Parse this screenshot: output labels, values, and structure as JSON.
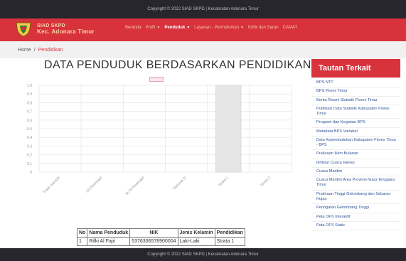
{
  "topbar": {
    "copyright": "Copyright © 2022 SIAD SKPD | Kecamatan Adonara Timur"
  },
  "brand": {
    "line1": "SIAD SKPD",
    "line2": "Kec. Adonara Timur"
  },
  "menu": {
    "items": [
      {
        "label": "Beranda",
        "dropdown": false,
        "active": false
      },
      {
        "label": "Profil",
        "dropdown": true,
        "active": false
      },
      {
        "label": "Penduduk",
        "dropdown": true,
        "active": true
      },
      {
        "label": "Layanan - Permohonan",
        "dropdown": true,
        "active": false
      },
      {
        "label": "Kritik dan Saran",
        "dropdown": false,
        "active": false
      },
      {
        "label": "CAMAT",
        "dropdown": false,
        "active": false
      }
    ]
  },
  "breadcrumb": {
    "home": "Home",
    "separator": "/",
    "current": "Pendidikan"
  },
  "page": {
    "title": "DATA PENDUDUK BERDASARKAN PENDIDIKAN"
  },
  "chart_data": {
    "type": "bar",
    "categories": [
      "Tidak Sekolah",
      "SD/Sederajat",
      "SLTP/Sederajat",
      "Diploma III",
      "Strata 1",
      "Strata 2"
    ],
    "values": [
      0,
      0,
      0,
      0,
      1,
      0
    ],
    "ylim": [
      0,
      1
    ],
    "yticks": [
      "0",
      "0.1",
      "0.2",
      "0.3",
      "0.4",
      "0.5",
      "0.6",
      "0.7",
      "0.8",
      "0.9",
      "1.0"
    ],
    "grid": true,
    "legend": "top-center",
    "colors": {
      "bar_fill": "#e6e6e6",
      "bar_stroke": "#d9d9d9",
      "legend_stroke": "#e8a0b0",
      "legend_fill": "#fbe5ea"
    }
  },
  "table": {
    "headers": [
      "No",
      "Nama Penduduk",
      "NIK",
      "Jenis Kelamin",
      "Pendidikan"
    ],
    "rows": [
      [
        "1",
        "Rifki Al Fajri",
        "5376306578900004",
        "Laki-Laki",
        "Strata 1"
      ]
    ]
  },
  "sidebar": {
    "title": "Tautan Terkait",
    "links": [
      "BPS NTT",
      "BPS Flores Timur",
      "Berita Resmi Statistik Flores Timur",
      "Publikasi Data Statistik Kabupaten Flores Timur",
      "Program dan Kegiatan BPS",
      "Metadata BPS Variabel",
      "Data Kependudukan Kabupaten Flores Timur - BPS",
      "Prakiraan Iklim Bulanan",
      "Ikhtisar Cuaca Harian",
      "Cuaca Maritim",
      "Cuaca Maritim Area Provinsi Nusa Tenggara Timur",
      "Prakiraan Tinggi Gelombang dan Sebaran Hujan",
      "Peringatan Gelombang Tinggi",
      "Peta OFS Interaktif",
      "Peta OFS Static"
    ]
  },
  "footer": {
    "copyright": "Copyright © 2022 SIAD SKPD | Kecamatan Adonara Timur"
  },
  "colors": {
    "brand_red": "#d8323c",
    "dark_bar": "#26262c",
    "link_blue": "#2f5597"
  },
  "icons": {
    "logo": "regency-emblem-icon",
    "caret": "caret-down-icon"
  }
}
